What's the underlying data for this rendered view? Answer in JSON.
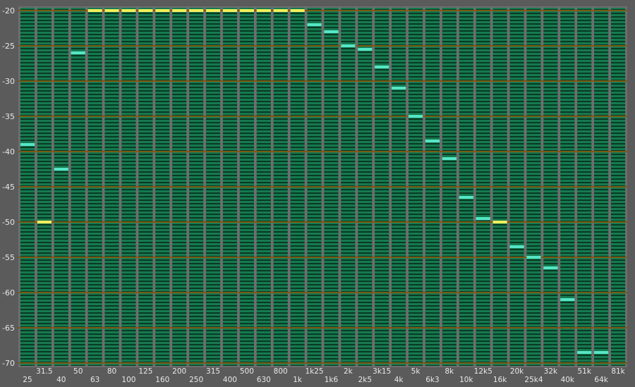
{
  "chart_data": {
    "type": "bar",
    "style": "spectrum-analyzer-peak-meter",
    "ylim": [
      -70,
      -20
    ],
    "y_ticks": [
      "-20",
      "-25",
      "-30",
      "-35",
      "-40",
      "-45",
      "-50",
      "-55",
      "-60",
      "-65",
      "-70"
    ],
    "grid": true,
    "categories": [
      "25",
      "31.5",
      "40",
      "50",
      "63",
      "80",
      "100",
      "125",
      "160",
      "200",
      "250",
      "315",
      "400",
      "500",
      "630",
      "800",
      "1k",
      "1k25",
      "1k6",
      "2k",
      "2k5",
      "3k15",
      "4k",
      "5k",
      "6k3",
      "8k",
      "10k",
      "12k5",
      "16k",
      "20k",
      "25k4",
      "32k",
      "40k",
      "51k",
      "64k",
      "81k"
    ],
    "values": [
      -39,
      -50,
      -42.5,
      -26,
      -20,
      -20,
      -20,
      -20,
      -20,
      -20,
      -20,
      -20,
      -20,
      -20,
      -20,
      -20,
      -20,
      -22,
      -23,
      -25,
      -25.5,
      -28,
      -31,
      -35,
      -38.5,
      -41,
      -46.5,
      -49.5,
      -50,
      -53.5,
      -55,
      -56.5,
      -61,
      -68.5,
      -68.5,
      null
    ],
    "highlighted": [
      false,
      true,
      false,
      false,
      true,
      true,
      true,
      true,
      true,
      true,
      true,
      true,
      true,
      true,
      true,
      true,
      true,
      false,
      false,
      false,
      false,
      false,
      false,
      false,
      false,
      false,
      false,
      false,
      true,
      false,
      false,
      false,
      false,
      false,
      false,
      false
    ]
  },
  "colors": {
    "background": "#5b5b5b",
    "column_bg": "#0a3a24",
    "segment": "#157a50",
    "column_gap": "#6e6e6e",
    "gridline": "#7a5a14",
    "peak": "#56e6c6",
    "peak_highlight": "#f2ee5a",
    "text": "#e8e8e8"
  }
}
